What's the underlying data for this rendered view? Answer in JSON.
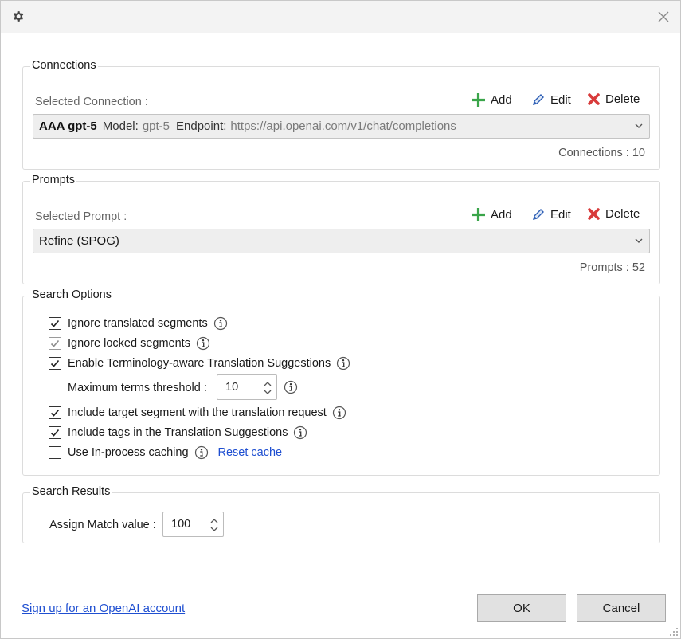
{
  "connections": {
    "title": "Connections",
    "selected_label": "Selected Connection :",
    "actions": {
      "add": "Add",
      "edit": "Edit",
      "delete": "Delete"
    },
    "selected": {
      "name": "AAA gpt-5",
      "model_key": "Model:",
      "model_value": "gpt-5",
      "endpoint_key": "Endpoint:",
      "endpoint_value": "https://api.openai.com/v1/chat/completions"
    },
    "count_text": "Connections : 10"
  },
  "prompts": {
    "title": "Prompts",
    "selected_label": "Selected Prompt :",
    "actions": {
      "add": "Add",
      "edit": "Edit",
      "delete": "Delete"
    },
    "selected": "Refine (SPOG)",
    "count_text": "Prompts : 52"
  },
  "search_options": {
    "title": "Search Options",
    "ignore_translated": {
      "label": "Ignore translated segments",
      "checked": true
    },
    "ignore_locked": {
      "label": "Ignore locked segments",
      "checked": true,
      "disabled": true
    },
    "enable_terminology": {
      "label": "Enable Terminology-aware Translation Suggestions",
      "checked": true
    },
    "max_terms": {
      "label": "Maximum terms threshold :",
      "value": "10"
    },
    "include_target": {
      "label": "Include target segment with the translation request",
      "checked": true
    },
    "include_tags": {
      "label": "Include tags in the Translation Suggestions",
      "checked": true
    },
    "in_process_caching": {
      "label": "Use In-process caching",
      "checked": false
    },
    "reset_cache": "Reset cache"
  },
  "search_results": {
    "title": "Search Results",
    "assign_match_label": "Assign Match value :",
    "assign_match_value": "100"
  },
  "footer": {
    "signup_link": "Sign up for an OpenAI account",
    "ok": "OK",
    "cancel": "Cancel"
  },
  "icons": {
    "settings": "gear-icon",
    "close": "close-icon",
    "add": "plus-icon",
    "edit": "pencil-icon",
    "delete": "x-icon",
    "info": "info-icon",
    "dropdown": "chevron-down-icon"
  },
  "colors": {
    "add": "#3aa54a",
    "delete": "#d83b3b",
    "edit": "#2f5fb5",
    "link": "#1f4fd1"
  }
}
